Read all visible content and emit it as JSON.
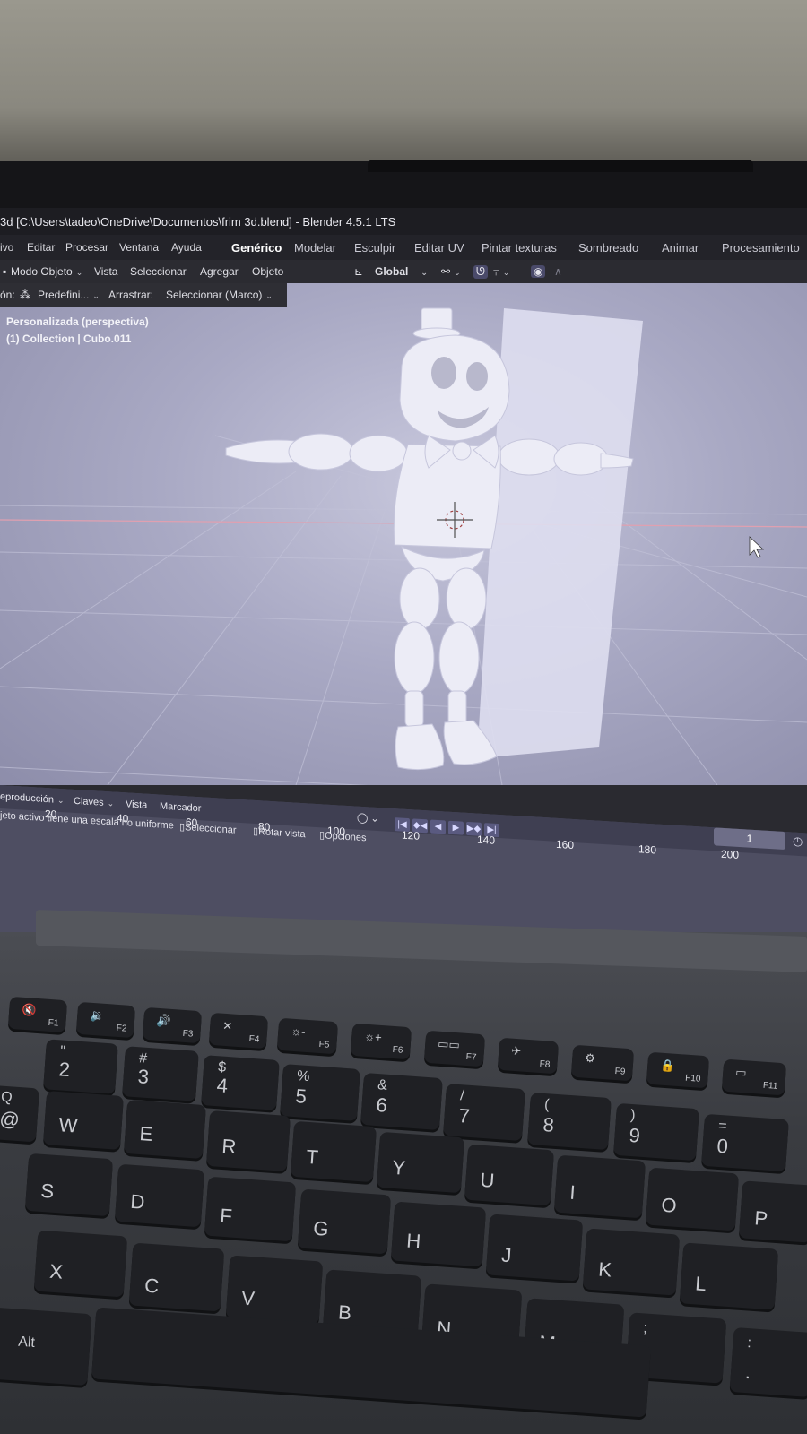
{
  "window": {
    "title": "3d [C:\\Users\\tadeo\\OneDrive\\Documentos\\frim 3d.blend] - Blender 4.5.1 LTS"
  },
  "menu": [
    "ivo",
    "Editar",
    "Procesar",
    "Ventana",
    "Ayuda"
  ],
  "workspaces": [
    "Genérico",
    "Modelar",
    "Esculpir",
    "Editar UV",
    "Pintar texturas",
    "Sombreado",
    "Animar",
    "Procesamiento"
  ],
  "viewport_header": {
    "mode": "Modo Objeto",
    "items": [
      "Vista",
      "Seleccionar",
      "Agregar",
      "Objeto"
    ],
    "transform": "Global"
  },
  "tool_settings": {
    "prefix": "ón:",
    "orientation": "Predefini...",
    "drag_label": "Arrastrar:",
    "drag_value": "Seleccionar (Marco)"
  },
  "viewport_info": {
    "view": "Personalizada (perspectiva)",
    "collection": "(1) Collection | Cubo.011"
  },
  "timeline": {
    "menu": [
      "eproducción",
      "Claves",
      "Vista",
      "Marcador"
    ],
    "ruler": [
      "20",
      "40",
      "60",
      "80",
      "100",
      "120",
      "140",
      "160",
      "180",
      "200"
    ],
    "current_frame": "1"
  },
  "statusbar": {
    "warning": "jeto activo tiene una escala no uniforme",
    "hints": [
      "Seleccionar",
      "Rotar vista",
      "Opciones"
    ]
  },
  "keyboard": {
    "fn_row": [
      {
        "label": "F1",
        "icon": "🔇"
      },
      {
        "label": "F2",
        "icon": "🔉"
      },
      {
        "label": "F3",
        "icon": "🔊"
      },
      {
        "label": "F4",
        "icon": "✕"
      },
      {
        "label": "F5",
        "icon": "☼-"
      },
      {
        "label": "F6",
        "icon": "☼+"
      },
      {
        "label": "F7",
        "icon": "▭▭"
      },
      {
        "label": "F8",
        "icon": "✈"
      },
      {
        "label": "F9",
        "icon": "⚙"
      },
      {
        "label": "F10",
        "icon": "🔒"
      },
      {
        "label": "F11",
        "icon": "▭"
      }
    ],
    "num_row": [
      {
        "main": "2",
        "shift": "\""
      },
      {
        "main": "3",
        "shift": "#"
      },
      {
        "main": "4",
        "shift": "$"
      },
      {
        "main": "5",
        "shift": "%"
      },
      {
        "main": "6",
        "shift": "&"
      },
      {
        "main": "7",
        "shift": "/"
      },
      {
        "main": "8",
        "shift": "("
      },
      {
        "main": "9",
        "shift": ")"
      },
      {
        "main": "0",
        "shift": "="
      }
    ],
    "q_row": [
      "Q",
      "W",
      "E",
      "R",
      "T",
      "Y",
      "U",
      "I",
      "O",
      "P"
    ],
    "q_sub": "@",
    "a_row": [
      "S",
      "D",
      "F",
      "G",
      "H",
      "J",
      "K",
      "L"
    ],
    "z_row": [
      "X",
      "C",
      "V",
      "B",
      "N",
      "M"
    ],
    "z_row_extra": [
      {
        "main": ";",
        "shift": ","
      },
      {
        "main": ":",
        "shift": "."
      }
    ],
    "alt": "Alt"
  },
  "colors": {
    "viewport": "#b4b4cc",
    "model": "#ececf6",
    "timeline": "#4e4e62",
    "titlebar": "#1d1d22"
  }
}
